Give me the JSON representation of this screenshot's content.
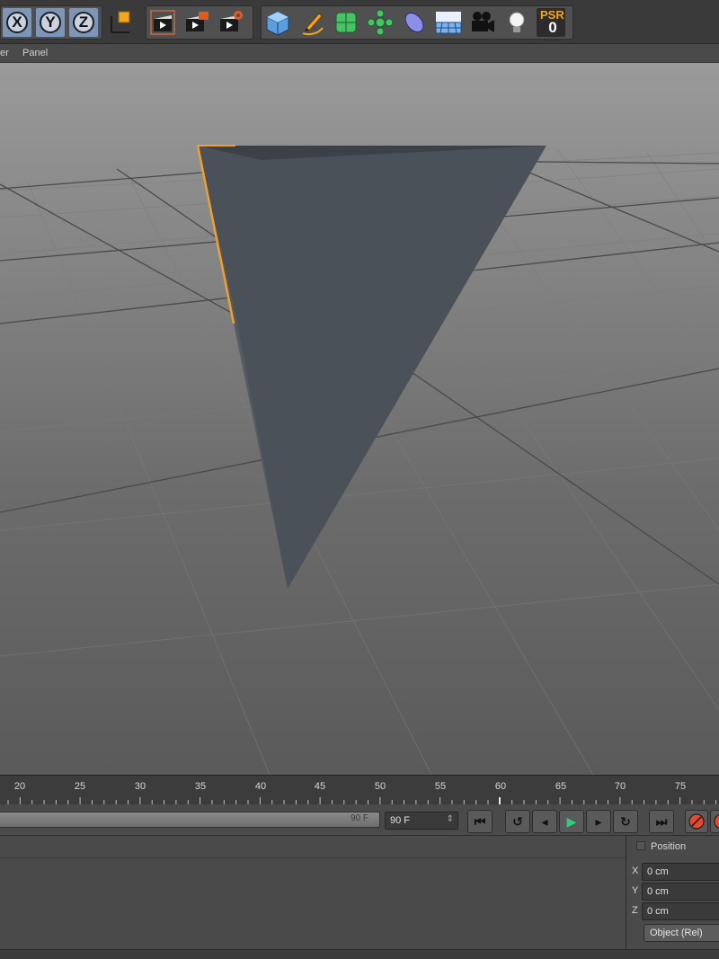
{
  "toolbar": {
    "axis_x_label": "X",
    "axis_y_label": "Y",
    "axis_z_label": "Z",
    "psr_label": "PSR",
    "psr_value": "0",
    "icons": [
      "coordinate-system-icon",
      "render-view-icon",
      "render-picture-viewer-icon",
      "render-settings-icon",
      "cube-icon",
      "pen-tool-icon",
      "subdivision-icon",
      "cloner-icon",
      "deformer-icon",
      "floor-icon",
      "camera-icon",
      "light-icon"
    ],
    "accent_color": "#f2a51e"
  },
  "menubar": {
    "items": [
      "er",
      "Panel"
    ]
  },
  "viewport": {
    "selection_edge_color": "#f0a030",
    "object_color": "#4b5159"
  },
  "timeline": {
    "ticks": [
      "20",
      "25",
      "30",
      "35",
      "40",
      "45",
      "50",
      "55",
      "60",
      "65",
      "70",
      "75"
    ]
  },
  "playbar": {
    "slider_end_label": "90 F",
    "frame_field_value": "90 F",
    "buttons": [
      "go-to-start-icon",
      "previous-keyframe-icon",
      "previous-frame-icon",
      "play-icon",
      "next-frame-icon",
      "next-keyframe-icon",
      "go-to-end-icon",
      "record-icon"
    ]
  },
  "coordinates": {
    "header": "Position",
    "x_label": "X",
    "x_value": "0 cm",
    "y_label": "Y",
    "y_value": "0 cm",
    "z_label": "Z",
    "z_value": "0 cm",
    "mode": "Object (Rel)"
  }
}
